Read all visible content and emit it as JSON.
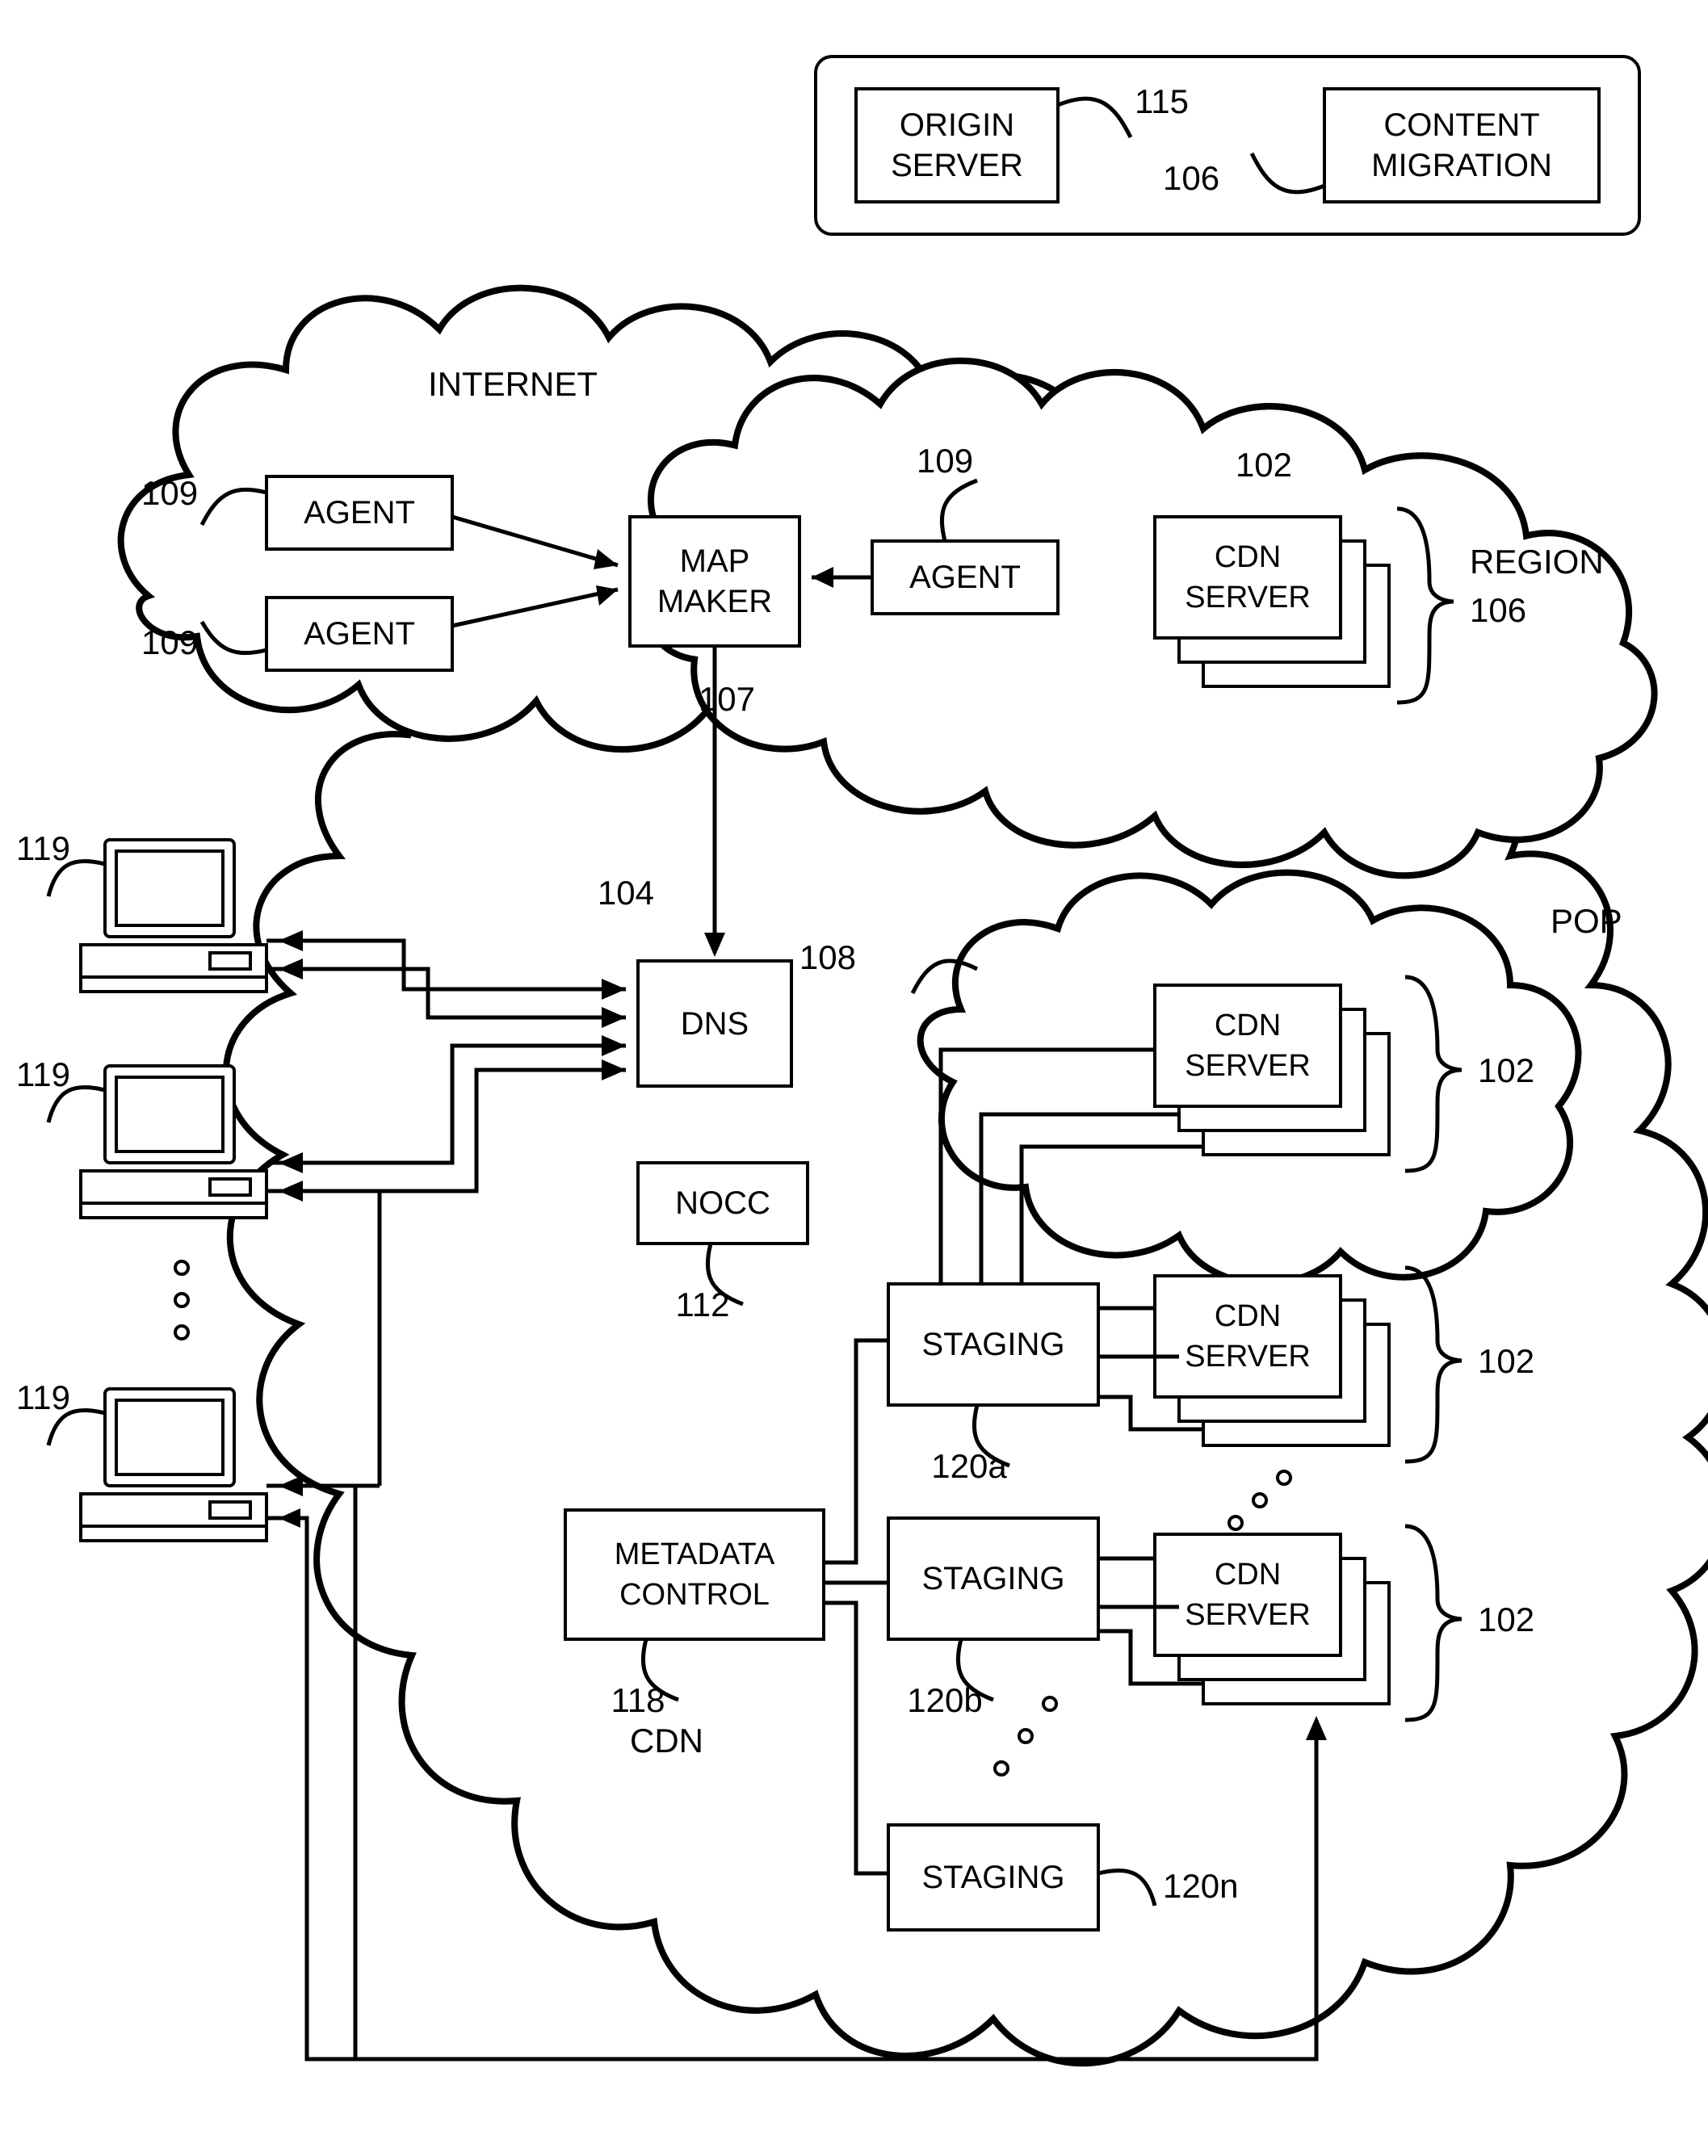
{
  "legend": {
    "origin": {
      "l1": "ORIGIN",
      "l2": "SERVER",
      "ref": "115"
    },
    "migration": {
      "l1": "CONTENT",
      "l2": "MIGRATION",
      "ref": "106"
    }
  },
  "internet_label": "INTERNET",
  "cdn_label": "CDN",
  "agents": {
    "label": "AGENT",
    "ref": "109"
  },
  "mapmaker": {
    "l1": "MAP",
    "l2": "MAKER",
    "ref": "107"
  },
  "dns": {
    "label": "DNS",
    "ref": "104"
  },
  "nocc": {
    "label": "NOCC",
    "ref": "112"
  },
  "metadata": {
    "l1": "METADATA",
    "l2": "CONTROL",
    "ref": "118"
  },
  "staging": {
    "label": "STAGING",
    "a": "120a",
    "b": "120b",
    "n": "120n"
  },
  "cdnserver": {
    "l1": "CDN",
    "l2": "SERVER",
    "ref": "102"
  },
  "region": {
    "label": "REGION",
    "ref": "106"
  },
  "pop": {
    "label": "POP",
    "ref": "108"
  },
  "clients": {
    "ref": "119"
  }
}
